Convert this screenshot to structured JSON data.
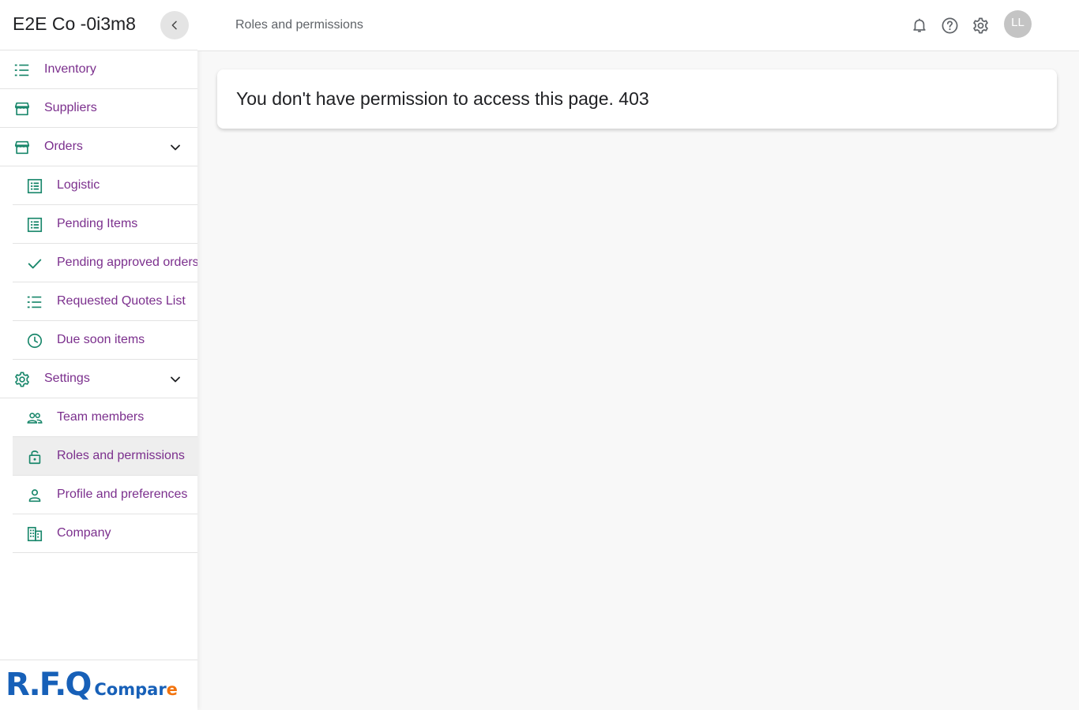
{
  "sidebar": {
    "company_name": "E2E Co -0i3m8",
    "items": [
      {
        "label": "Inventory",
        "icon": "list-numbered-icon"
      },
      {
        "label": "Suppliers",
        "icon": "storefront-icon"
      },
      {
        "label": "Orders",
        "icon": "storefront-icon",
        "expanded": true
      },
      {
        "label": "Logistic",
        "icon": "list-alt-icon"
      },
      {
        "label": "Pending Items",
        "icon": "list-alt-icon"
      },
      {
        "label": "Pending approved orders",
        "icon": "check-icon"
      },
      {
        "label": "Requested Quotes List",
        "icon": "list-numbered-icon"
      },
      {
        "label": "Due soon items",
        "icon": "clock-icon"
      },
      {
        "label": "Settings",
        "icon": "gear-icon",
        "expanded": true
      },
      {
        "label": "Team members",
        "icon": "people-icon"
      },
      {
        "label": "Roles and permissions",
        "icon": "lock-open-icon",
        "active": true
      },
      {
        "label": "Profile and preferences",
        "icon": "person-icon"
      },
      {
        "label": "Company",
        "icon": "building-icon"
      }
    ],
    "logo": {
      "rfq": "R.F.Q",
      "compare_a": "Compar",
      "compare_b": "e"
    }
  },
  "header": {
    "breadcrumb": "Roles and permissions",
    "avatar_initials": "LL"
  },
  "main": {
    "message": "You don't have permission to access this page. 403"
  },
  "colors": {
    "icon_green": "#19876b",
    "label_purple": "#7b2f8d",
    "logo_blue": "#1760b8",
    "logo_orange": "#f2730d"
  }
}
